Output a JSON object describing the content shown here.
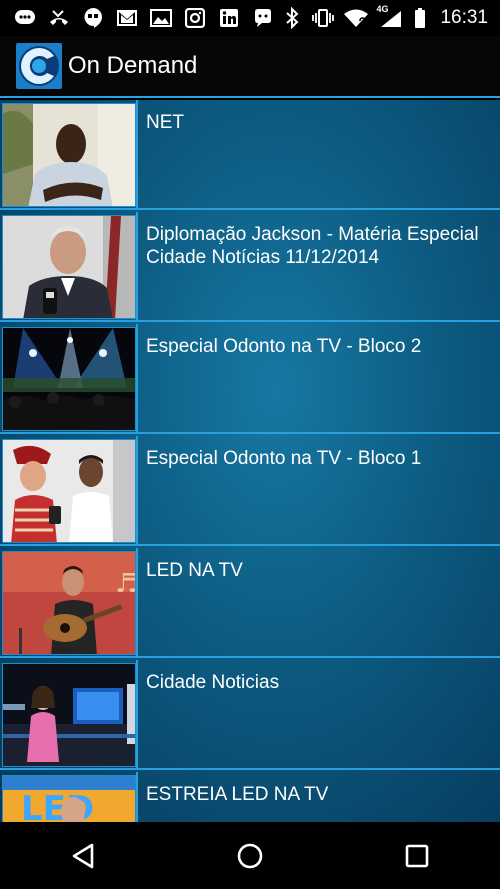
{
  "status_bar": {
    "time": "16:31",
    "network": "4G",
    "left_icons": [
      "messenger-icon",
      "missed-call-icon",
      "hangouts-icon",
      "gmail-icon",
      "photos-icon",
      "instagram-icon",
      "linkedin-icon",
      "whatsapp-icon"
    ],
    "right_icons": [
      "bluetooth-icon",
      "vibrate-icon",
      "wifi-icon",
      "signal-icon",
      "battery-icon"
    ]
  },
  "action_bar": {
    "title": "On Demand",
    "logo": "app-logo"
  },
  "videos": [
    {
      "title": "NET",
      "thumbnail": "thumbnail-man-interview"
    },
    {
      "title": "Diplomação Jackson - Matéria Especial Cidade Notícias 11/12/2014",
      "thumbnail": "thumbnail-man-microphone"
    },
    {
      "title": "Especial Odonto na TV - Bloco 2",
      "thumbnail": "thumbnail-concert-stage"
    },
    {
      "title": "Especial Odonto na TV - Bloco 1",
      "thumbnail": "thumbnail-pirate-interview"
    },
    {
      "title": "LED NA TV",
      "thumbnail": "thumbnail-guitarist"
    },
    {
      "title": "Cidade Noticias",
      "thumbnail": "thumbnail-news-studio"
    },
    {
      "title": "ESTREIA LED NA TV",
      "thumbnail": "thumbnail-led-show"
    }
  ],
  "nav_bar": {
    "buttons": [
      "back-button",
      "home-button",
      "recents-button"
    ]
  }
}
